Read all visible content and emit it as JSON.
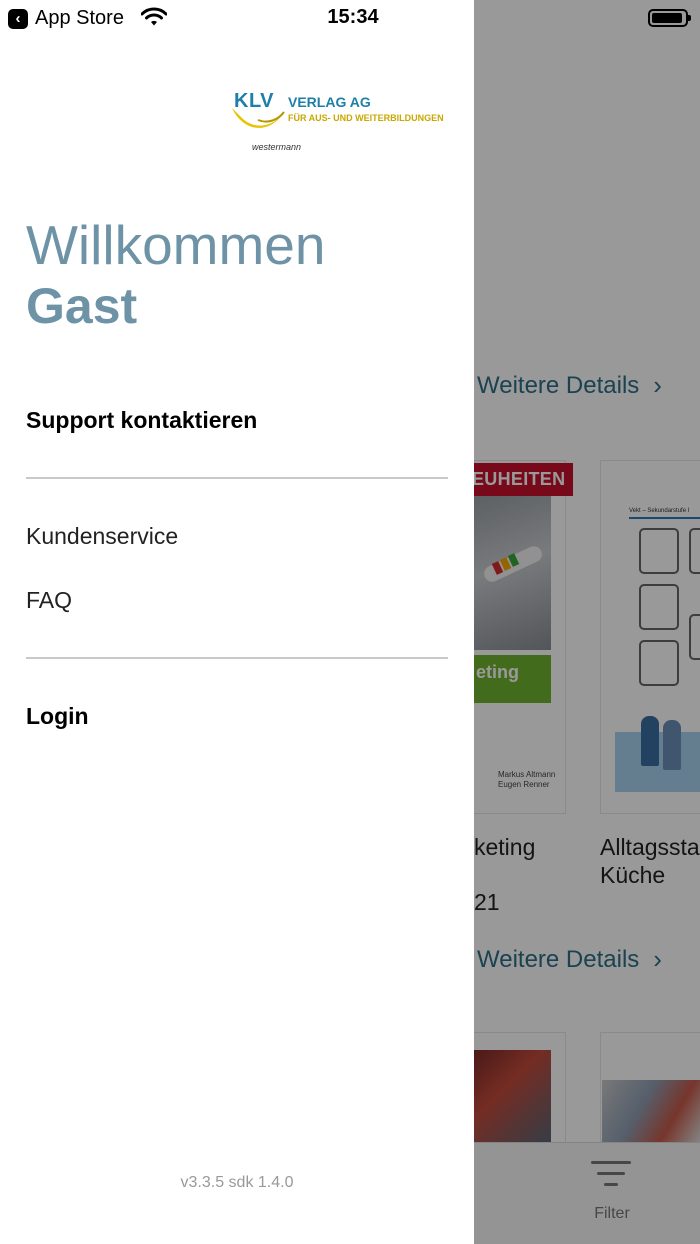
{
  "status_bar": {
    "back_app_label": "App Store",
    "time": "15:34"
  },
  "drawer": {
    "logo": {
      "klv": "KLV",
      "name": "VERLAG AG",
      "tagline": "FÜR AUS- UND WEITERBILDUNGEN",
      "parent": "westermann"
    },
    "welcome": "Willkommen",
    "user_name": "Gast",
    "support_title": "Support kontaktieren",
    "menu_items": [
      {
        "label": "Kundenservice"
      },
      {
        "label": "FAQ"
      }
    ],
    "login_label": "Login",
    "version": "v3.3.5 sdk 1.4.0"
  },
  "background": {
    "details_link_1": "Weitere Details",
    "details_link_2": "Weitere Details",
    "ribbon": "EUHEITEN",
    "cover_band_text": "eting",
    "cover_authors_line1": "Markus Altmann",
    "cover_authors_line2": "Eugen Renner",
    "worksheet_header": "Vekt – Sekundarstufe I",
    "book_a_title": "keting",
    "book_a_year": "21",
    "book_b_title_line1": "Alltagssta",
    "book_b_title_line2": "Küche",
    "filter_label": "Filter"
  },
  "colors": {
    "welcome_text": "#6e93a7",
    "link": "#2e6f86",
    "ribbon": "#c8102e",
    "logo_blue": "#1e7fa8",
    "logo_yellow": "#c9a800"
  }
}
